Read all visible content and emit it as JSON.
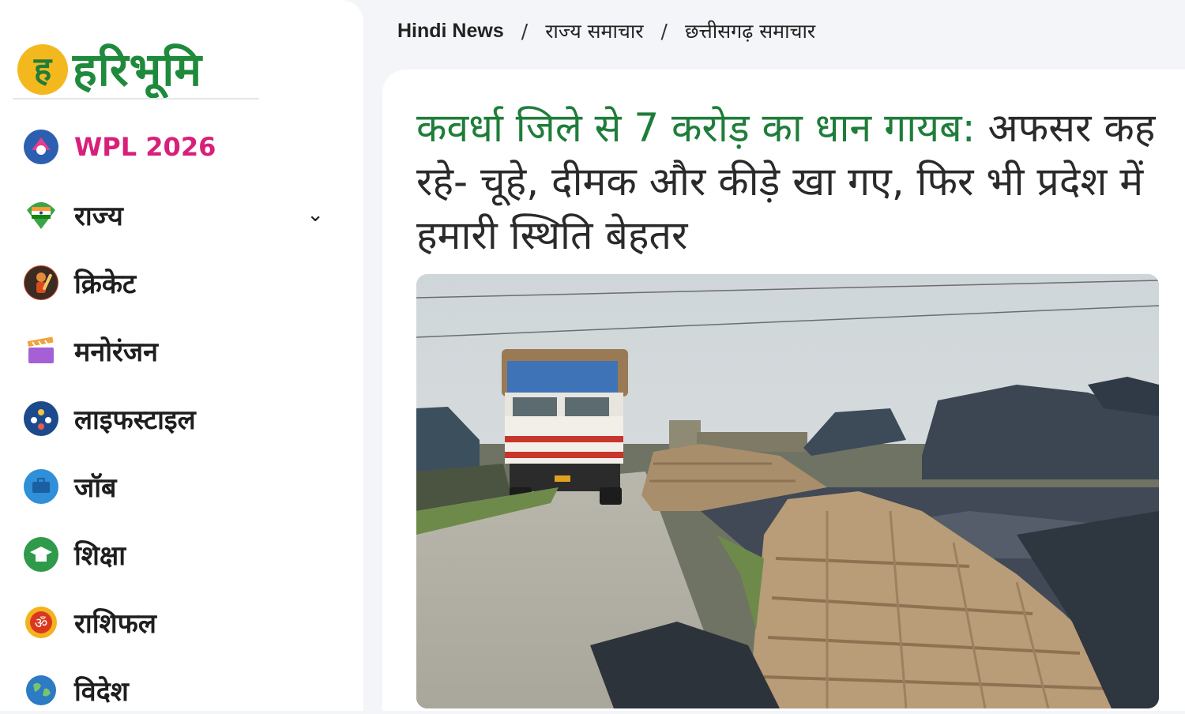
{
  "logo": {
    "badge": "ह",
    "text": "हरिभूमि"
  },
  "sidebar": {
    "items": [
      {
        "label": "WPL 2026",
        "icon": "wpl-logo-icon",
        "color": "#2d5fb0"
      },
      {
        "label": "राज्य",
        "icon": "india-map-icon",
        "color": "#3aa44a",
        "has_chevron": true
      },
      {
        "label": "क्रिकेट",
        "icon": "cricket-player-icon",
        "color": "#c8401f"
      },
      {
        "label": "मनोरंजन",
        "icon": "clapperboard-icon",
        "color": "#a660d6"
      },
      {
        "label": "लाइफस्टाइल",
        "icon": "lifestyle-icon",
        "color": "#1d4a8c"
      },
      {
        "label": "जॉब",
        "icon": "job-icon",
        "color": "#2f8fd8"
      },
      {
        "label": "शिक्षा",
        "icon": "education-icon",
        "color": "#2f9a4a"
      },
      {
        "label": "राशिफल",
        "icon": "om-icon",
        "color": "#d9381e"
      },
      {
        "label": "विदेश",
        "icon": "globe-icon",
        "color": "#2c7bc4"
      }
    ]
  },
  "breadcrumb": {
    "items": [
      "Hindi News",
      "राज्य समाचार",
      "छत्तीसगढ़ समाचार"
    ],
    "separator": "/"
  },
  "article": {
    "headline_highlight": "कवर्धा जिले से 7 करोड़ का धान गायब:",
    "headline_rest": " अफसर कह रहे- चूहे, दीमक और कीड़े खा गए, फिर भी प्रदेश में हमारी स्थिति बेहतर",
    "highlight_color": "#1f7d3a"
  }
}
